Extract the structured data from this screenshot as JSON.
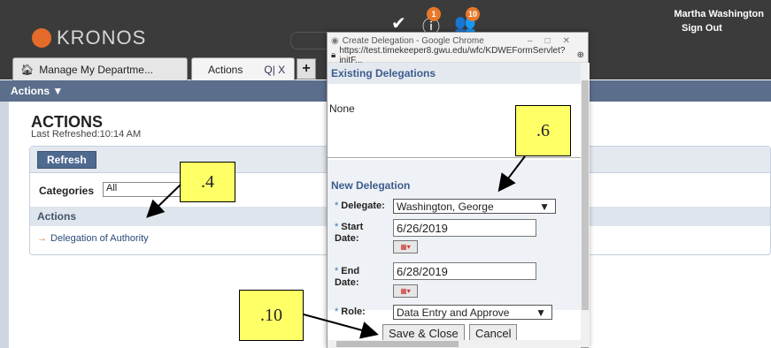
{
  "header": {
    "logo_text": "KRONOS",
    "notifications_badge": "1",
    "people_badge": "10",
    "user_name": "Martha Washington",
    "sign_out": "Sign Out"
  },
  "tabs": [
    {
      "label": "Manage My Departme..."
    },
    {
      "label": "Actions",
      "controls": "Q| X"
    }
  ],
  "tab_add": "+",
  "actions_menu": "Actions ▼",
  "page": {
    "title": "ACTIONS",
    "last_refreshed": "Last Refreshed:10:14 AM",
    "refresh_button": "Refresh",
    "categories_label": "Categories",
    "categories_value": "All",
    "section": "Actions",
    "link": "Delegation of Authority"
  },
  "popup": {
    "window_title": "Create Delegation - Google Chrome",
    "url": "https://test.timekeeper8.gwu.edu/wfc/KDWEFormServlet?initF...",
    "existing_heading": "Existing Delegations",
    "existing_value": "None",
    "new_heading": "New Delegation",
    "delegate_label": "Delegate:",
    "delegate_value": "Washington, George",
    "start_label_1": "Start",
    "start_label_2": "Date:",
    "start_value": "6/26/2019",
    "end_label_1": "End",
    "end_label_2": "Date:",
    "end_value": "6/28/2019",
    "role_label": "Role:",
    "role_value": "Data Entry and Approve",
    "save_button": "Save & Close",
    "cancel_button": "Cancel"
  },
  "callouts": {
    "c4": ".4",
    "c6": ".6",
    "c10": ".10"
  },
  "colors": {
    "header_bg": "#3b3b3b",
    "brand_orange": "#e46b2a",
    "actions_bar": "#5b6e8c",
    "callout": "#ffff66"
  }
}
